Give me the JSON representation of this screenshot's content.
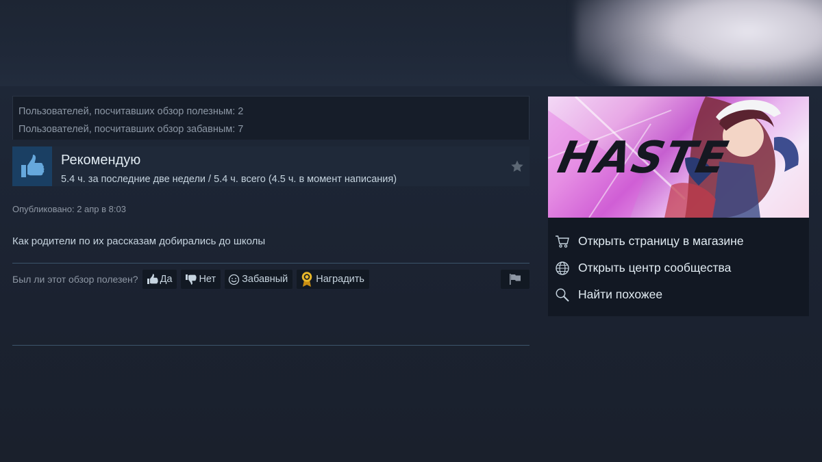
{
  "review": {
    "helpful_count_text": "Пользователей, посчитавших обзор полезным: 2",
    "funny_count_text": "Пользователей, посчитавших обзор забавным: 7",
    "recommendation": "Рекомендую",
    "hours": "5.4 ч. за последние две недели / 5.4 ч. всего (4.5 ч. в момент написания)",
    "posted": "Опубликовано: 2 апр в 8:03",
    "text": "Как родители по их рассказам добирались до школы"
  },
  "vote": {
    "question": "Был ли этот обзор полезен?",
    "yes_label": "Да",
    "no_label": "Нет",
    "funny_label": "Забавный",
    "award_label": "Наградить"
  },
  "game": {
    "logo_text": "HASTE"
  },
  "sidebar_links": {
    "store": "Открыть страницу в магазине",
    "community": "Открыть центр сообщества",
    "similar": "Найти похожее"
  },
  "colors": {
    "background": "#1b2230",
    "panel": "#121823",
    "recommend_blue": "#1a3f63",
    "award_gold": "#d9a726"
  }
}
